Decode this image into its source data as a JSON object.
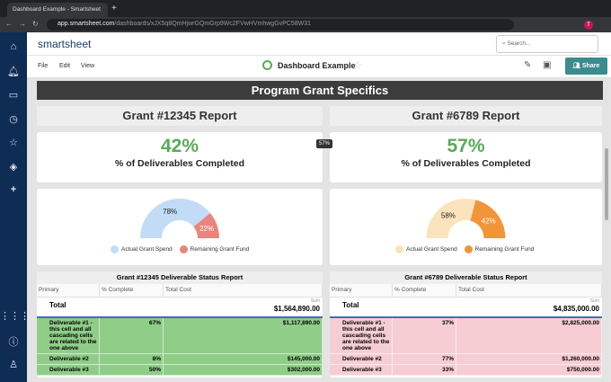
{
  "browser": {
    "tab_title": "Dashboard Example - Smartsheet",
    "url_host": "app.smartsheet.com",
    "url_path": "/dashboards/xJX5q8QmHjwrGQmGrp9Wc2FVwHVmhwgGvPC58W31",
    "avatar_letter": "T"
  },
  "sidebar": {
    "icons": [
      "home-icon",
      "bell-icon",
      "folder-icon",
      "clock-icon",
      "star-icon",
      "diamond-icon",
      "plus-icon",
      "apps-icon",
      "help-icon",
      "user-icon"
    ]
  },
  "header": {
    "logo": "smartsheet",
    "search_placeholder": "Search..."
  },
  "toolbar": {
    "menus": [
      "File",
      "Edit",
      "View"
    ],
    "title": "Dashboard Example",
    "share": "Share"
  },
  "dashboard": {
    "banner": "Program Grant Specifics",
    "tooltip": "57%",
    "grants": [
      {
        "title": "Grant #12345 Report",
        "percent": "42%",
        "percent_label": "% of Deliverables Completed",
        "chart": {
          "spend": 78,
          "remaining": 22,
          "spend_label": "78%",
          "remaining_label": "22%",
          "legend": [
            "Actual Grant Spend",
            "Remaining Grant Fund"
          ],
          "colors": [
            "#c2dcf7",
            "#e8857e"
          ]
        },
        "report": {
          "title": "Grant #12345 Deliverable Status Report",
          "columns": [
            "Primary",
            "% Complete",
            "Total Cost"
          ],
          "total_label": "Total",
          "sum_label": "Sum",
          "total": "$1,564,890.00",
          "row_color": "#8fcd88",
          "rows": [
            {
              "name": "Deliverable #1 - this cell and all cascading cells are related to the one above",
              "pct": "67%",
              "cost": "$1,117,890.00"
            },
            {
              "name": "Deliverable #2",
              "pct": "8%",
              "cost": "$145,000.00"
            },
            {
              "name": "Deliverable #3",
              "pct": "50%",
              "cost": "$302,000.00"
            }
          ]
        }
      },
      {
        "title": "Grant #6789 Report",
        "percent": "57%",
        "percent_label": "% of Deliverables Completed",
        "chart": {
          "spend": 58,
          "remaining": 42,
          "spend_label": "58%",
          "remaining_label": "42%",
          "legend": [
            "Actual Grant Spend",
            "Remaining Grant Fund"
          ],
          "colors": [
            "#fae3bd",
            "#f0953a"
          ]
        },
        "report": {
          "title": "Grant #6789 Deliverable Status Report",
          "columns": [
            "Primary",
            "% Complete",
            "Total Cost"
          ],
          "total_label": "Total",
          "sum_label": "Sum",
          "total": "$4,835,000.00",
          "row_color": "#f6cdd3",
          "rows": [
            {
              "name": "Deliverable #1 - this cell and all cascading cells are related to the one above",
              "pct": "37%",
              "cost": "$2,825,000.00"
            },
            {
              "name": "Deliverable #2",
              "pct": "77%",
              "cost": "$1,260,000.00"
            },
            {
              "name": "Deliverable #3",
              "pct": "33%",
              "cost": "$750,000.00"
            }
          ]
        }
      }
    ]
  }
}
